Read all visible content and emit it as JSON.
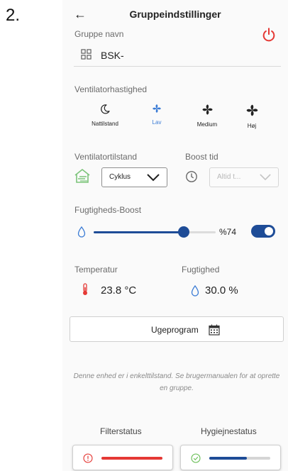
{
  "step_label": "2.",
  "header": {
    "title": "Gruppeindstillinger"
  },
  "colors": {
    "accent_blue": "#3a7bd5",
    "slider_blue": "#1e4c97",
    "alert_red": "#e53935",
    "ok_green": "#6bbf59",
    "house_green": "#7cc47a"
  },
  "group": {
    "label": "Gruppe navn",
    "name_value": "BSK-"
  },
  "fan_speed": {
    "label": "Ventilatorhastighed",
    "options": [
      {
        "label": "Nattilstand",
        "icon": "moon-icon",
        "active": false
      },
      {
        "label": "Lav",
        "icon": "fan-icon",
        "active": true
      },
      {
        "label": "Medium",
        "icon": "fan-icon",
        "active": false
      },
      {
        "label": "Høj",
        "icon": "fan-icon",
        "active": false
      }
    ]
  },
  "fan_mode": {
    "label": "Ventilatortilstand",
    "selected": "Cyklus"
  },
  "boost_time": {
    "label": "Boost tid",
    "placeholder": "Altid t..."
  },
  "humidity_boost": {
    "label": "Fugtigheds-Boost",
    "value_percent": 74,
    "value_text": "%74",
    "enabled": true
  },
  "temperature": {
    "label": "Temperatur",
    "value": "23.8 °C"
  },
  "humidity": {
    "label": "Fugtighed",
    "value": "30.0 %"
  },
  "week_program": {
    "label": "Ugeprogram"
  },
  "info_text": "Denne enhed er i enkelttilstand. Se brugermanualen for at oprette en gruppe.",
  "filter_status": {
    "label": "Filterstatus",
    "level": 1.0,
    "state": "alert"
  },
  "hygiene_status": {
    "label": "Hygiejnestatus",
    "level": 0.62,
    "state": "ok"
  }
}
